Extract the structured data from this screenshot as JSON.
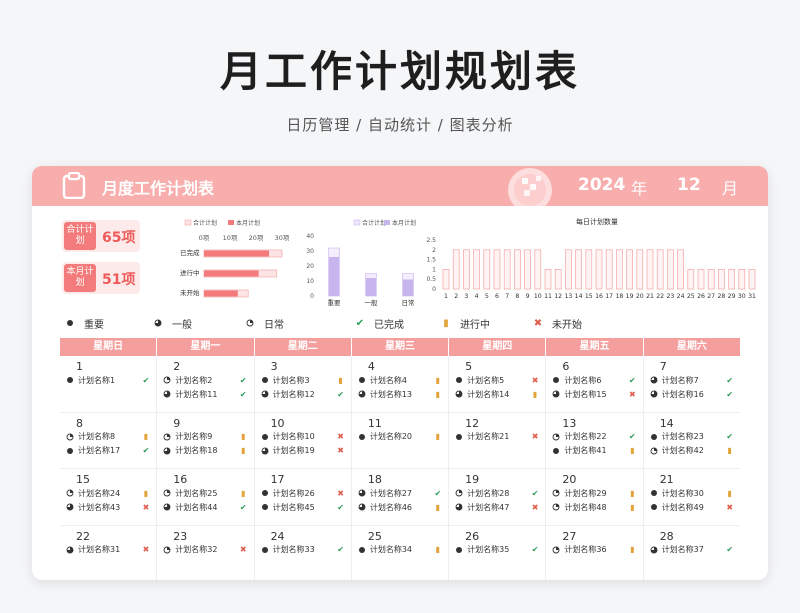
{
  "hero": {
    "title": "月工作计划规划表",
    "subtitle": "日历管理 / 自动统计 / 图表分析"
  },
  "header": {
    "title": "月度工作计划表",
    "year": "2024",
    "year_unit": "年",
    "month": "12",
    "month_unit": "月"
  },
  "stats": {
    "total_label": "合计计划",
    "total_value": "65项",
    "month_label": "本月计划",
    "month_value": "51项"
  },
  "colors": {
    "accent": "#f37b7b",
    "header_bg": "#f9aeae",
    "done": "#2e9e5b",
    "progress": "#e2a33b",
    "notstart": "#e06050",
    "purple": "#c8b5ee"
  },
  "chart_data": [
    {
      "type": "bar",
      "orientation": "horizontal",
      "categories": [
        "已完成",
        "进行中",
        "未开始"
      ],
      "series": [
        {
          "name": "合计计划",
          "values": [
            30,
            28,
            17
          ]
        },
        {
          "name": "本月计划",
          "values": [
            25,
            21,
            13
          ]
        }
      ],
      "x_ticks": [
        "0项",
        "10项",
        "20项",
        "30项"
      ],
      "xlim": [
        0,
        30
      ]
    },
    {
      "type": "bar",
      "categories": [
        "重要",
        "一般",
        "日常"
      ],
      "series": [
        {
          "name": "合计计划",
          "values": [
            32,
            15,
            15
          ]
        },
        {
          "name": "本月计划",
          "values": [
            26,
            12,
            11
          ]
        }
      ],
      "y_ticks": [
        "0",
        "10",
        "20",
        "30",
        "40"
      ],
      "ylim": [
        0,
        40
      ]
    },
    {
      "type": "bar",
      "title": "每日计划数量",
      "categories": [
        "1",
        "2",
        "3",
        "4",
        "5",
        "6",
        "7",
        "8",
        "9",
        "10",
        "11",
        "12",
        "13",
        "14",
        "15",
        "16",
        "17",
        "18",
        "19",
        "20",
        "21",
        "22",
        "23",
        "24",
        "25",
        "26",
        "27",
        "28",
        "29",
        "30",
        "31"
      ],
      "values": [
        1,
        2,
        2,
        2,
        2,
        2,
        2,
        2,
        2,
        2,
        1,
        1,
        2,
        2,
        2,
        2,
        2,
        2,
        2,
        2,
        2,
        2,
        2,
        2,
        1,
        1,
        1,
        1,
        1,
        1,
        1
      ],
      "y_ticks": [
        "0",
        "0.5",
        "1",
        "1.5",
        "2",
        "2.5"
      ],
      "ylim": [
        0,
        2.5
      ]
    }
  ],
  "legend": [
    {
      "icon": "important",
      "label": "重要"
    },
    {
      "icon": "normal",
      "label": "一般"
    },
    {
      "icon": "daily",
      "label": "日常"
    },
    {
      "icon": "done",
      "label": "已完成"
    },
    {
      "icon": "progress",
      "label": "进行中"
    },
    {
      "icon": "notstart",
      "label": "未开始"
    }
  ],
  "calendar": {
    "weekdays": [
      "星期日",
      "星期一",
      "星期二",
      "星期三",
      "星期四",
      "星期五",
      "星期六"
    ],
    "weeks": [
      [
        {
          "day": "1",
          "tasks": [
            {
              "p": "important",
              "name": "计划名称1",
              "s": "done"
            }
          ]
        },
        {
          "day": "2",
          "tasks": [
            {
              "p": "daily",
              "name": "计划名称2",
              "s": "done"
            },
            {
              "p": "normal",
              "name": "计划名称11",
              "s": "done"
            }
          ]
        },
        {
          "day": "3",
          "tasks": [
            {
              "p": "important",
              "name": "计划名称3",
              "s": "progress"
            },
            {
              "p": "normal",
              "name": "计划名称12",
              "s": "done"
            }
          ]
        },
        {
          "day": "4",
          "tasks": [
            {
              "p": "important",
              "name": "计划名称4",
              "s": "progress"
            },
            {
              "p": "normal",
              "name": "计划名称13",
              "s": "progress"
            }
          ]
        },
        {
          "day": "5",
          "tasks": [
            {
              "p": "important",
              "name": "计划名称5",
              "s": "notstart"
            },
            {
              "p": "normal",
              "name": "计划名称14",
              "s": "progress"
            }
          ]
        },
        {
          "day": "6",
          "tasks": [
            {
              "p": "important",
              "name": "计划名称6",
              "s": "done"
            },
            {
              "p": "normal",
              "name": "计划名称15",
              "s": "notstart"
            }
          ]
        },
        {
          "day": "7",
          "tasks": [
            {
              "p": "normal",
              "name": "计划名称7",
              "s": "done"
            },
            {
              "p": "normal",
              "name": "计划名称16",
              "s": "done"
            }
          ]
        }
      ],
      [
        {
          "day": "8",
          "tasks": [
            {
              "p": "daily",
              "name": "计划名称8",
              "s": "progress"
            },
            {
              "p": "important",
              "name": "计划名称17",
              "s": "done"
            }
          ]
        },
        {
          "day": "9",
          "tasks": [
            {
              "p": "daily",
              "name": "计划名称9",
              "s": "progress"
            },
            {
              "p": "normal",
              "name": "计划名称18",
              "s": "progress"
            }
          ]
        },
        {
          "day": "10",
          "tasks": [
            {
              "p": "important",
              "name": "计划名称10",
              "s": "notstart"
            },
            {
              "p": "normal",
              "name": "计划名称19",
              "s": "notstart"
            }
          ]
        },
        {
          "day": "11",
          "tasks": [
            {
              "p": "important",
              "name": "计划名称20",
              "s": "progress"
            }
          ]
        },
        {
          "day": "12",
          "tasks": [
            {
              "p": "important",
              "name": "计划名称21",
              "s": "notstart"
            }
          ]
        },
        {
          "day": "13",
          "tasks": [
            {
              "p": "daily",
              "name": "计划名称22",
              "s": "done"
            },
            {
              "p": "important",
              "name": "计划名称41",
              "s": "progress"
            }
          ]
        },
        {
          "day": "14",
          "tasks": [
            {
              "p": "important",
              "name": "计划名称23",
              "s": "done"
            },
            {
              "p": "daily",
              "name": "计划名称42",
              "s": "progress"
            }
          ]
        }
      ],
      [
        {
          "day": "15",
          "tasks": [
            {
              "p": "daily",
              "name": "计划名称24",
              "s": "progress"
            },
            {
              "p": "normal",
              "name": "计划名称43",
              "s": "notstart"
            }
          ]
        },
        {
          "day": "16",
          "tasks": [
            {
              "p": "daily",
              "name": "计划名称25",
              "s": "progress"
            },
            {
              "p": "normal",
              "name": "计划名称44",
              "s": "done"
            }
          ]
        },
        {
          "day": "17",
          "tasks": [
            {
              "p": "important",
              "name": "计划名称26",
              "s": "notstart"
            },
            {
              "p": "important",
              "name": "计划名称45",
              "s": "done"
            }
          ]
        },
        {
          "day": "18",
          "tasks": [
            {
              "p": "normal",
              "name": "计划名称27",
              "s": "done"
            },
            {
              "p": "normal",
              "name": "计划名称46",
              "s": "progress"
            }
          ]
        },
        {
          "day": "19",
          "tasks": [
            {
              "p": "daily",
              "name": "计划名称28",
              "s": "done"
            },
            {
              "p": "normal",
              "name": "计划名称47",
              "s": "notstart"
            }
          ]
        },
        {
          "day": "20",
          "tasks": [
            {
              "p": "daily",
              "name": "计划名称29",
              "s": "progress"
            },
            {
              "p": "daily",
              "name": "计划名称48",
              "s": "progress"
            }
          ]
        },
        {
          "day": "21",
          "tasks": [
            {
              "p": "important",
              "name": "计划名称30",
              "s": "progress"
            },
            {
              "p": "important",
              "name": "计划名称49",
              "s": "notstart"
            }
          ]
        }
      ],
      [
        {
          "day": "22",
          "tasks": [
            {
              "p": "normal",
              "name": "计划名称31",
              "s": "notstart"
            }
          ]
        },
        {
          "day": "23",
          "tasks": [
            {
              "p": "daily",
              "name": "计划名称32",
              "s": "notstart"
            }
          ]
        },
        {
          "day": "24",
          "tasks": [
            {
              "p": "important",
              "name": "计划名称33",
              "s": "done"
            }
          ]
        },
        {
          "day": "25",
          "tasks": [
            {
              "p": "important",
              "name": "计划名称34",
              "s": "progress"
            }
          ]
        },
        {
          "day": "26",
          "tasks": [
            {
              "p": "important",
              "name": "计划名称35",
              "s": "done"
            }
          ]
        },
        {
          "day": "27",
          "tasks": [
            {
              "p": "daily",
              "name": "计划名称36",
              "s": "progress"
            }
          ]
        },
        {
          "day": "28",
          "tasks": [
            {
              "p": "normal",
              "name": "计划名称37",
              "s": "done"
            }
          ]
        }
      ]
    ]
  }
}
